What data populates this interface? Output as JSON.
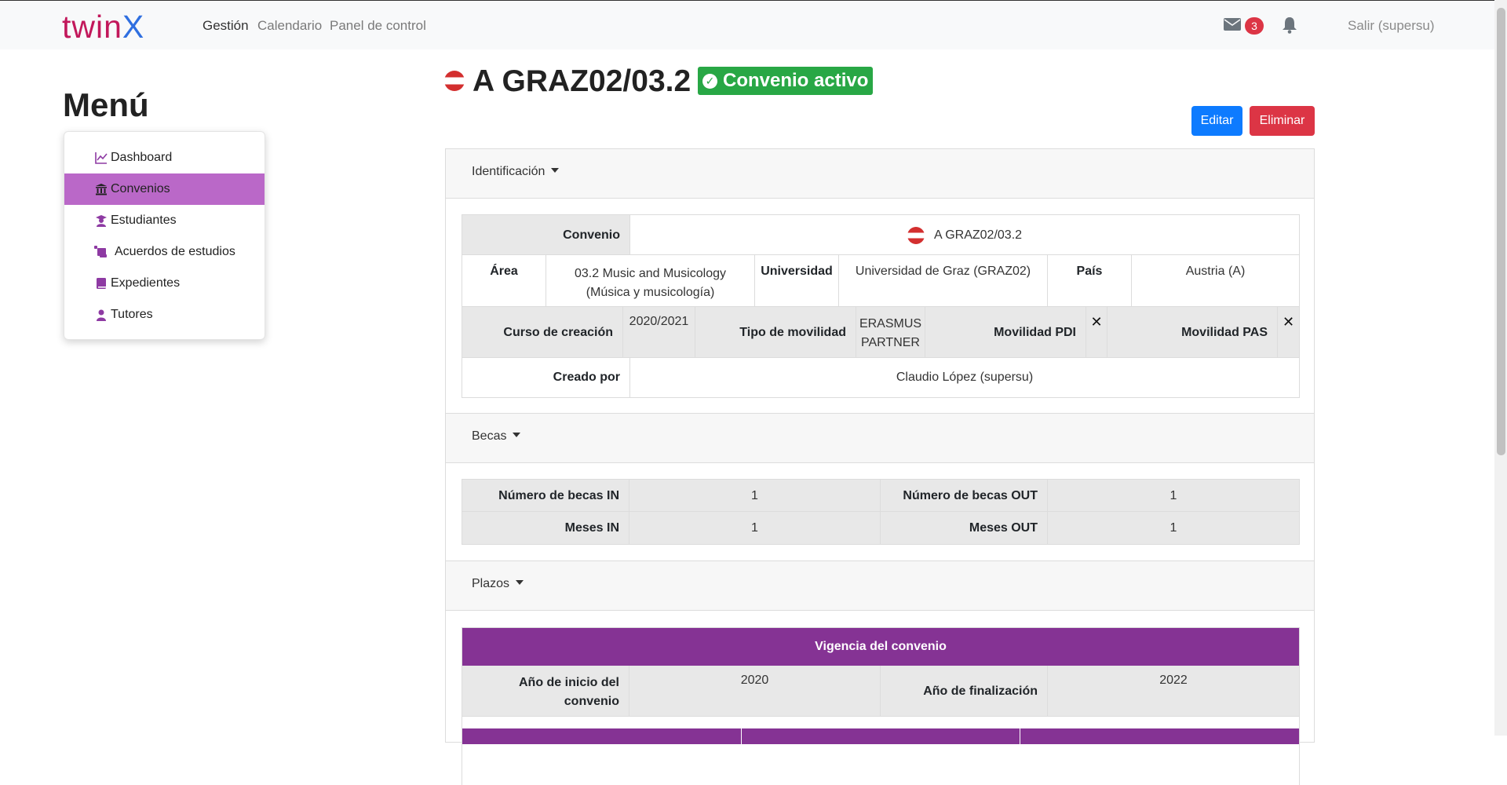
{
  "brand": {
    "part1": "twin",
    "part2": "X"
  },
  "nav": {
    "gestion": "Gestión",
    "calendario": "Calendario",
    "panel": "Panel de control"
  },
  "header": {
    "mail_count": "3",
    "logout": "Salir (supersu)"
  },
  "menu": {
    "title": "Menú",
    "items": [
      {
        "label": "Dashboard",
        "icon": "chart-line-icon"
      },
      {
        "label": "Convenios",
        "icon": "institution-icon"
      },
      {
        "label": "Estudiantes",
        "icon": "graduate-icon"
      },
      {
        "label": "Acuerdos de estudios",
        "icon": "scroll-icon"
      },
      {
        "label": "Expedientes",
        "icon": "book-icon"
      },
      {
        "label": "Tutores",
        "icon": "teacher-icon"
      }
    ],
    "active_item": "Convenios"
  },
  "page": {
    "title": "A GRAZ02/03.2",
    "status": "Convenio activo",
    "edit_label": "Editar",
    "delete_label": "Eliminar"
  },
  "identificacion": {
    "header": "Identificación",
    "convenio_label": "Convenio",
    "convenio_value": "A GRAZ02/03.2",
    "area_label": "Área",
    "area_value_1": "03.2 Music and Musicology",
    "area_value_2": "(Música y musicología)",
    "universidad_label": "Universidad",
    "universidad_value": "Universidad de Graz (GRAZ02)",
    "pais_label": "País",
    "pais_value": "Austria (A)",
    "curso_label": "Curso de creación",
    "curso_value": "2020/2021",
    "tipo_label": "Tipo de movilidad",
    "tipo_value_1": "ERASMUS",
    "tipo_value_2": "PARTNER",
    "pdi_label": "Movilidad PDI",
    "pdi_value": "✕",
    "pas_label": "Movilidad PAS",
    "pas_value": "✕",
    "creado_label": "Creado por",
    "creado_value": "Claudio López (supersu)"
  },
  "becas": {
    "header": "Becas",
    "in_label": "Número de becas IN",
    "in_value": "1",
    "out_label": "Número de becas OUT",
    "out_value": "1",
    "meses_in_label": "Meses IN",
    "meses_in_value": "1",
    "meses_out_label": "Meses OUT",
    "meses_out_value": "1"
  },
  "plazos": {
    "header": "Plazos",
    "vigencia": "Vigencia del convenio",
    "inicio_label_1": "Año de inicio del",
    "inicio_label_2": "convenio",
    "inicio_value": "2020",
    "fin_label": "Año de finalización",
    "fin_value": "2022"
  },
  "colors": {
    "accent": "#853394",
    "menu_active": "#ba68c8",
    "success": "#28a745",
    "danger": "#dc3545",
    "primary": "#0d7bff"
  }
}
